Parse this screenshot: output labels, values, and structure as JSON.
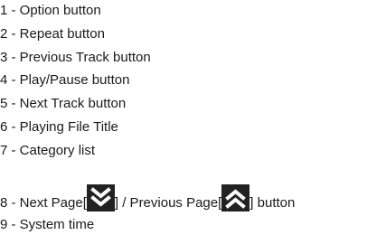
{
  "items": [
    "1 - Option button",
    "2 - Repeat button",
    "3 - Previous Track button",
    "4 - Play/Pause button",
    "5 - Next Track button",
    "6 - Playing File Title",
    "7 - Category list"
  ],
  "item8": {
    "prefix": "8 - Next Page[",
    "middle": "] / Previous Page[",
    "suffix": "] button",
    "next_icon": "double-chevron-down-icon",
    "prev_icon": "double-chevron-up-icon"
  },
  "item9": "9 - System time",
  "colors": {
    "icon_background": "#222222",
    "icon_glyph": "#ffffff"
  }
}
